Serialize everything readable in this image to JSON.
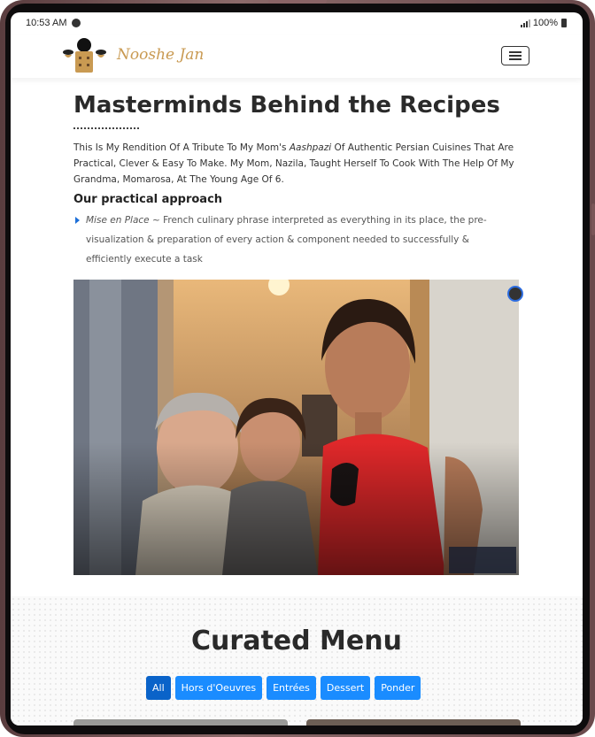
{
  "status": {
    "time": "10:53 AM",
    "battery": "100%"
  },
  "nav": {
    "brand": "Nooshe Jan"
  },
  "main": {
    "title": "Masterminds Behind the Recipes",
    "intro_before": "This Is My Rendition Of A Tribute To My Mom's ",
    "intro_em": "Aashpazi",
    "intro_after": " Of Authentic Persian Cuisines That Are Practical, Clever & Easy To Make. My Mom, Nazila, Taught Herself To Cook With The Help Of My Grandma, Momarosa, At The Young Age Of 6.",
    "approach_heading": "Our practical approach",
    "bullet_em": "Mise en Place",
    "bullet_text": " ~ French culinary phrase interpreted as everything in its place, the pre-visualization & preparation of every action & component needed to successfully & efficiently execute a task"
  },
  "menu": {
    "title": "Curated Menu",
    "filters": [
      "All",
      "Hors d'Oeuvres",
      "Entrées",
      "Dessert",
      "Ponder"
    ],
    "active_filter": "All"
  },
  "colors": {
    "brand": "#c99a52",
    "accent": "#1a8cff",
    "accent_active": "#0a63c9",
    "text": "#2a2a2a"
  },
  "icons": {
    "menu": "hamburger-icon",
    "bullet": "caret-right-icon",
    "logo": "chef-hat-logo"
  }
}
